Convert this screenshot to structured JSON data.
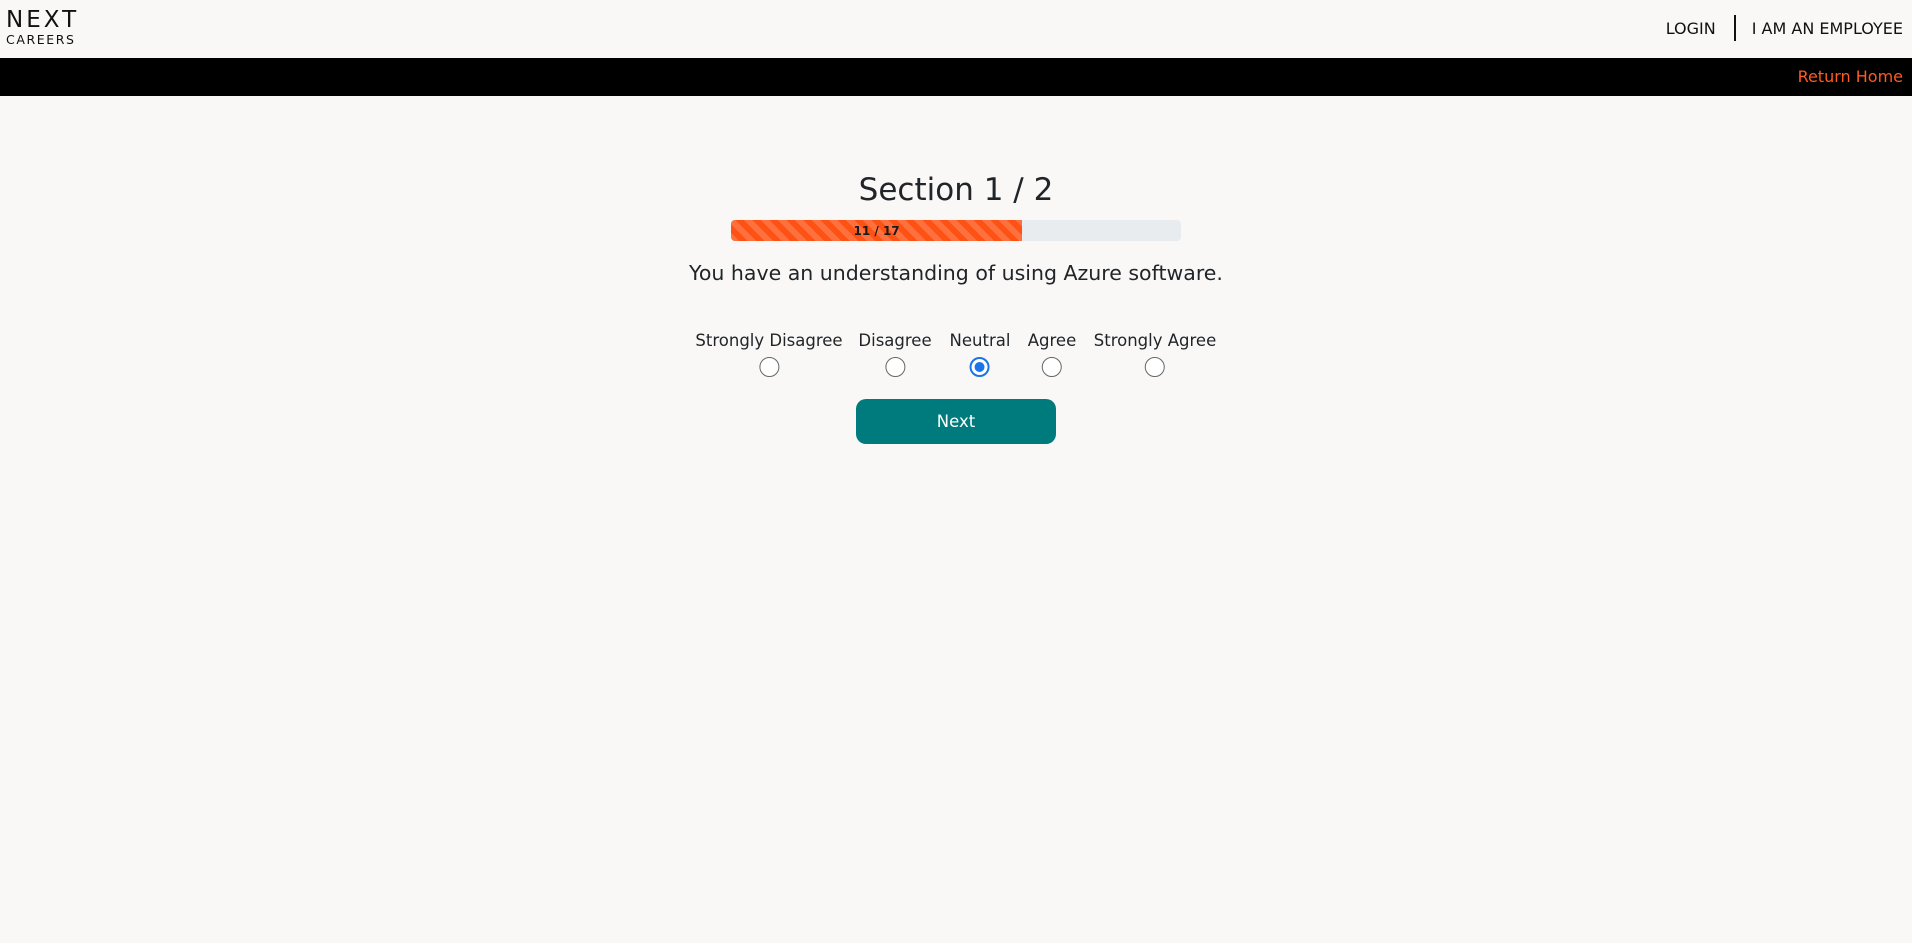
{
  "header": {
    "logo_line1": "NEXT",
    "logo_line2": "CAREERS",
    "login_label": "LOGIN",
    "employee_label": "I AM AN EMPLOYEE"
  },
  "banner": {
    "return_home_label": "Return Home",
    "link_color": "#ff5a1f"
  },
  "survey": {
    "section_title": "Section 1 / 2",
    "progress": {
      "label": "11 / 17",
      "current": 11,
      "total": 17,
      "fill_color": "#fe5215"
    },
    "question": "You have an understanding of using Azure software.",
    "options": [
      {
        "label": "Strongly Disagree",
        "selected": false
      },
      {
        "label": "Disagree",
        "selected": false
      },
      {
        "label": "Neutral",
        "selected": true
      },
      {
        "label": "Agree",
        "selected": false
      },
      {
        "label": "Strongly Agree",
        "selected": false
      }
    ],
    "next_label": "Next",
    "next_color": "#007b7d"
  }
}
